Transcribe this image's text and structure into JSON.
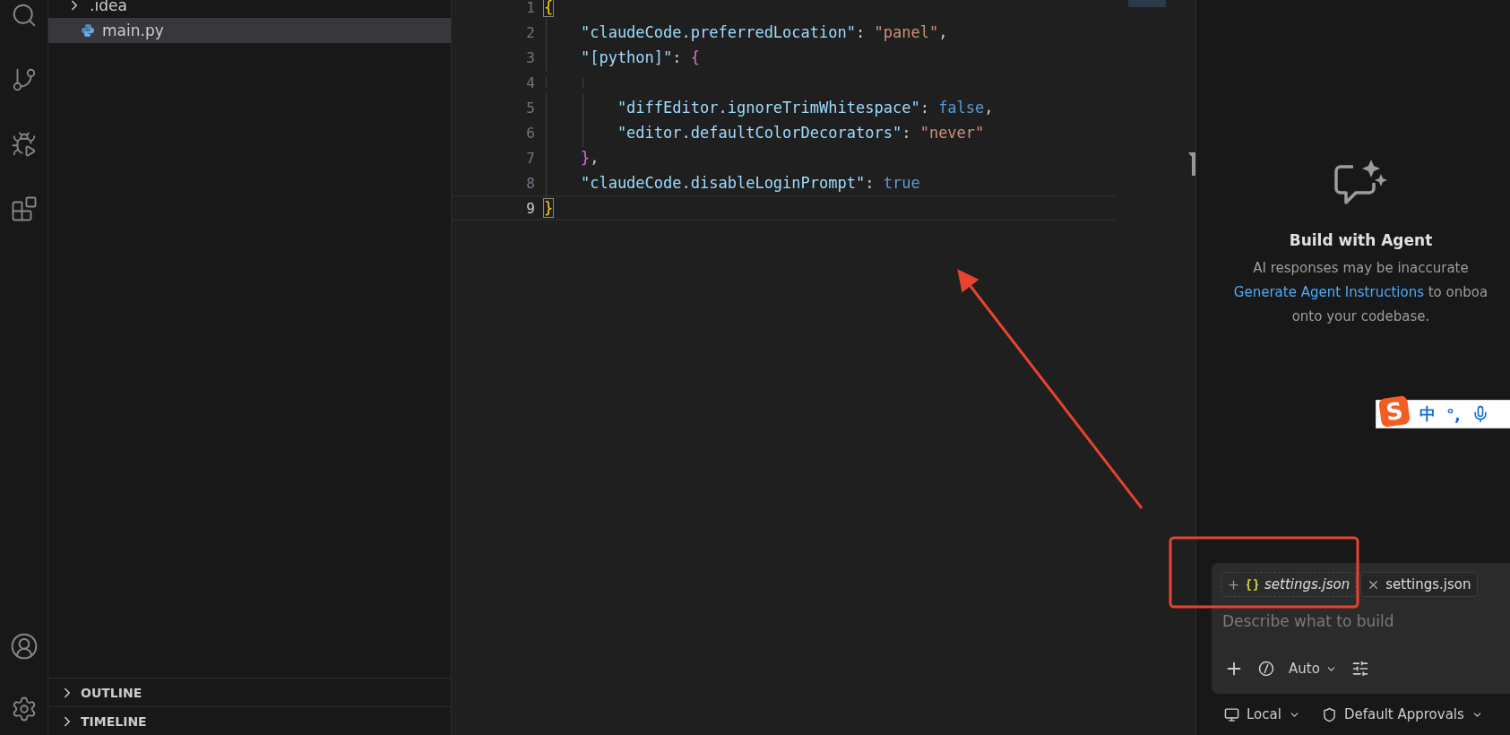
{
  "explorer": {
    "items": [
      {
        "label": ".idea",
        "kind": "folder",
        "expanded": false,
        "selected": false
      },
      {
        "label": "main.py",
        "kind": "python",
        "selected": true
      }
    ],
    "sections": [
      {
        "label": "OUTLINE",
        "expanded": false
      },
      {
        "label": "TIMELINE",
        "expanded": false
      }
    ]
  },
  "editor": {
    "lines": [
      {
        "number": "1",
        "active": false,
        "tokens": [
          {
            "text": "{",
            "kind": "brace1",
            "matched": true
          }
        ]
      },
      {
        "number": "2",
        "active": false,
        "tokens": [
          {
            "text": "    \"claudeCode.preferredLocation\"",
            "kind": "key"
          },
          {
            "text": ": ",
            "kind": "punct"
          },
          {
            "text": "\"panel\"",
            "kind": "string"
          },
          {
            "text": ",",
            "kind": "punct"
          }
        ]
      },
      {
        "number": "3",
        "active": false,
        "tokens": [
          {
            "text": "    \"[python]\"",
            "kind": "key"
          },
          {
            "text": ": ",
            "kind": "punct"
          },
          {
            "text": "{",
            "kind": "brace2",
            "matched": false
          }
        ]
      },
      {
        "number": "4",
        "active": false
      },
      {
        "number": "5",
        "active": false,
        "tokens": [
          {
            "text": "        \"diffEditor.ignoreTrimWhitespace\"",
            "kind": "key"
          },
          {
            "text": ": ",
            "kind": "punct"
          },
          {
            "text": "false",
            "kind": "keyword"
          },
          {
            "text": ",",
            "kind": "punct"
          }
        ]
      },
      {
        "number": "6",
        "active": false,
        "tokens": [
          {
            "text": "        \"editor.defaultColorDecorators\"",
            "kind": "key"
          },
          {
            "text": ": ",
            "kind": "punct"
          },
          {
            "text": "\"never\"",
            "kind": "string"
          }
        ]
      },
      {
        "number": "7",
        "active": false,
        "tokens": [
          {
            "text": "    }",
            "kind": "brace2",
            "matched": false
          },
          {
            "text": ",",
            "kind": "punct"
          }
        ]
      },
      {
        "number": "8",
        "active": false,
        "tokens": [
          {
            "text": "    \"claudeCode.disableLoginPrompt\"",
            "kind": "key"
          },
          {
            "text": ": ",
            "kind": "punct"
          },
          {
            "text": "true",
            "kind": "keyword"
          }
        ]
      },
      {
        "number": "9",
        "active": true,
        "tokens": [
          {
            "text": "}",
            "kind": "brace1",
            "matched": true
          }
        ]
      }
    ]
  },
  "agent": {
    "title": "Build with Agent",
    "description": {
      "before": "AI responses may be inaccurate",
      "link": "Generate Agent Instructions",
      "after": " to onboa",
      "end": "onto your codebase."
    },
    "composer": {
      "chips": [
        {
          "kind": "suggested",
          "label": "settings.json"
        },
        {
          "kind": "attached",
          "label": "settings.json"
        }
      ],
      "placeholder": "Describe what to build",
      "mode": "Auto"
    },
    "footer": [
      {
        "kind": "target",
        "label": "Local"
      },
      {
        "kind": "approvals",
        "label": "Default Approvals"
      }
    ]
  },
  "ime": {
    "logo": "S",
    "items": [
      "中",
      "°,"
    ]
  }
}
